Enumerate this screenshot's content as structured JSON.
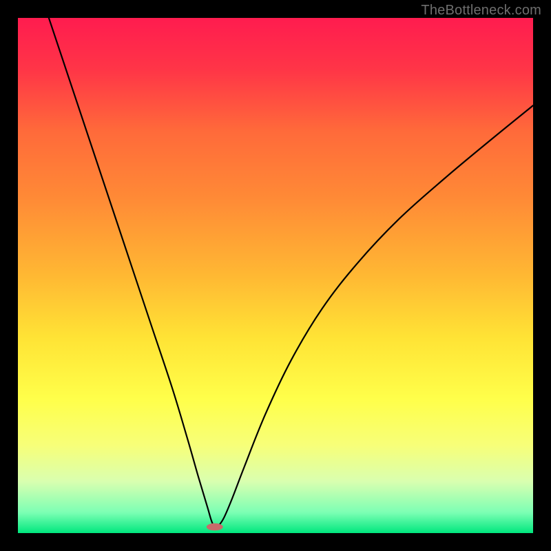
{
  "watermark": "TheBottleneck.com",
  "chart_data": {
    "type": "line",
    "title": "",
    "xlabel": "",
    "ylabel": "",
    "xlim": [
      0,
      100
    ],
    "ylim": [
      0,
      100
    ],
    "series": [
      {
        "name": "curve",
        "x": [
          6,
          10,
          14,
          18,
          22,
          26,
          30,
          33,
          35,
          36.8,
          37.5,
          38,
          38.4,
          39,
          40,
          41.5,
          44,
          48,
          53,
          59,
          66,
          74,
          83,
          92,
          100
        ],
        "y": [
          100,
          88,
          76,
          64,
          52,
          40,
          28,
          18,
          11,
          5,
          2.6,
          1.4,
          1.2,
          1.5,
          3,
          6.5,
          13,
          23,
          33.5,
          43.5,
          52.5,
          61,
          69,
          76.5,
          83
        ]
      }
    ],
    "marker": {
      "x": 38.2,
      "y": 1.2,
      "rx": 1.6,
      "ry": 0.7,
      "color": "#c86a6a"
    },
    "gradient_stops": [
      {
        "offset": 0.0,
        "color": "#ff1c4f"
      },
      {
        "offset": 0.1,
        "color": "#ff3547"
      },
      {
        "offset": 0.22,
        "color": "#ff6a3a"
      },
      {
        "offset": 0.35,
        "color": "#ff8a36"
      },
      {
        "offset": 0.5,
        "color": "#ffb833"
      },
      {
        "offset": 0.62,
        "color": "#ffe335"
      },
      {
        "offset": 0.74,
        "color": "#ffff4a"
      },
      {
        "offset": 0.83,
        "color": "#f7ff79"
      },
      {
        "offset": 0.9,
        "color": "#d9ffb0"
      },
      {
        "offset": 0.96,
        "color": "#7cffb4"
      },
      {
        "offset": 1.0,
        "color": "#00e77e"
      }
    ]
  }
}
